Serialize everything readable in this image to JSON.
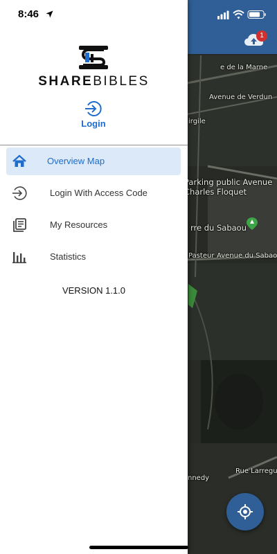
{
  "status_bar": {
    "time": "8:46"
  },
  "app": {
    "brand_bold": "SHARE",
    "brand_light": "BIBLES",
    "login_label": "Login",
    "version": "VERSION 1.1.0",
    "accent_color": "#1e6ccd",
    "active_bg": "#dce9f8"
  },
  "menu": {
    "items": [
      {
        "label": "Overview Map",
        "icon": "home-icon",
        "active": true
      },
      {
        "label": "Login With Access Code",
        "icon": "login-arrow-icon",
        "active": false
      },
      {
        "label": "My Resources",
        "icon": "resources-icon",
        "active": false
      },
      {
        "label": "Statistics",
        "icon": "bar-chart-icon",
        "active": false
      }
    ]
  },
  "map": {
    "header_color": "#2f5f96",
    "sync_badge_count": "1",
    "labels": {
      "marne": "e de la Marne",
      "verdun": "Avenue de Verdun",
      "virgil": "irgile",
      "parking1": "Parking public Avenue",
      "parking2": "Charles Floquet",
      "sabaou_park": "rre du Sabaou",
      "pasteur": "Pasteur",
      "sabaou_ave": "Avenue du Sabaou",
      "larreguy": "Rue Larreguy",
      "nnedy": "nnedy"
    }
  }
}
